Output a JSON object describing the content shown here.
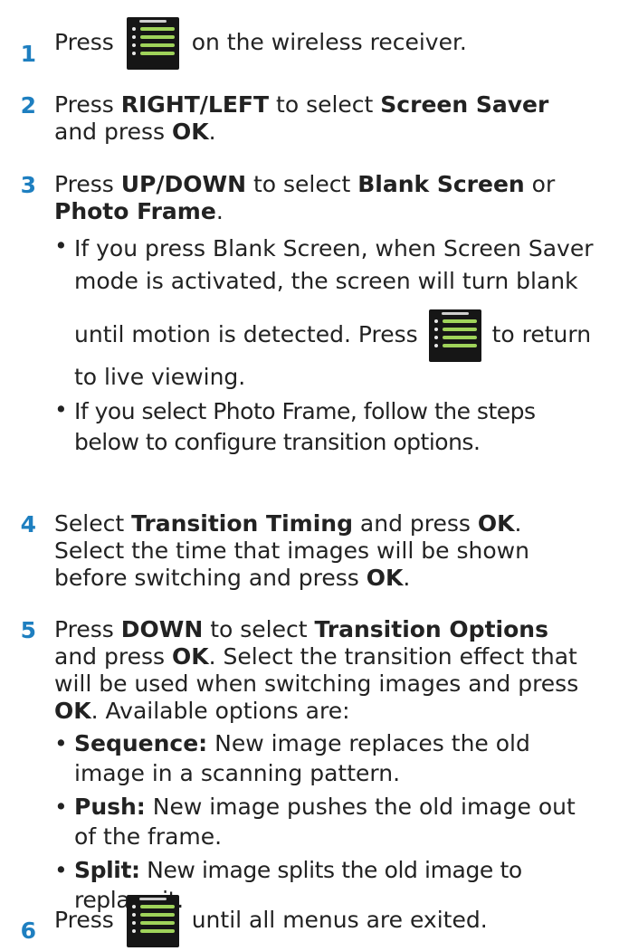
{
  "colors": {
    "accent": "#1e7fc0"
  },
  "icons": {
    "menu": "menu-button-icon"
  },
  "steps": [
    {
      "number": "1",
      "t1": "Press",
      "t2": "on the wireless receiver."
    },
    {
      "number": "2",
      "t1": "Press ",
      "b1": "RIGHT/LEFT",
      "t2": " to select ",
      "b2": "Screen Saver",
      "t3": " and press ",
      "b3": "OK",
      "t4": "."
    },
    {
      "number": "3",
      "t1": "Press ",
      "b1": "UP/DOWN",
      "t2": " to select ",
      "b2": "Blank Screen",
      "t3": " or ",
      "b3": "Photo Frame",
      "t4": ".",
      "bullets": [
        {
          "t1": "If you press Blank Screen, when Screen Saver mode is activated, the screen will turn blank",
          "t2": "until motion is detected. Press",
          "t3": "to return",
          "t4": "to live viewing."
        },
        {
          "t1": "If you select Photo Frame, follow the steps below to configure transition options."
        }
      ]
    },
    {
      "number": "4",
      "t1": "Select ",
      "b1": "Transition Timing",
      "t2": " and press ",
      "b2": "OK",
      "t3": ". Select the time that images will be shown before switching and press ",
      "b3": "OK",
      "t4": "."
    },
    {
      "number": "5",
      "t1": "Press ",
      "b1": "DOWN",
      "t2": " to select ",
      "b2": "Transition Options",
      "t3": " and press ",
      "b3": "OK",
      "t4": ". Select the transition effect that will be used when switching images and press ",
      "b4": "OK",
      "t5": ". Available options are:",
      "bullets": [
        {
          "label": "Sequence:",
          "text": " New image replaces the old image in a scanning pattern."
        },
        {
          "label": "Push:",
          "text": " New image pushes the old image out of the frame."
        },
        {
          "label": "Split:",
          "text": " New image splits the old image to replace it."
        }
      ]
    },
    {
      "number": "6",
      "t1": "Press",
      "t2": "until all menus are exited."
    }
  ]
}
